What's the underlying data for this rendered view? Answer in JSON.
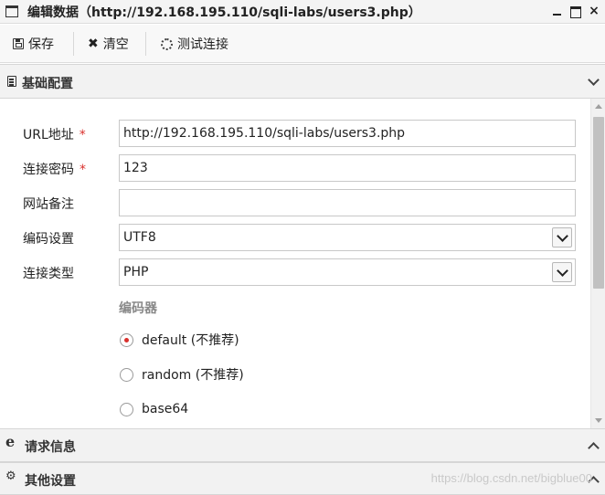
{
  "window": {
    "title": "编辑数据（http://192.168.195.110/sqli-labs/users3.php）",
    "minimize": "_",
    "close": "×"
  },
  "toolbar": {
    "save_label": "保存",
    "clear_label": "清空",
    "test_label": "测试连接"
  },
  "sections": {
    "basic": "基础配置",
    "request": "请求信息",
    "other": "其他设置"
  },
  "form": {
    "url_label": "URL地址",
    "url_value": "http://192.168.195.110/sqli-labs/users3.php",
    "password_label": "连接密码",
    "password_value": "123",
    "note_label": "网站备注",
    "note_value": "",
    "encoding_label": "编码设置",
    "encoding_value": "UTF8",
    "type_label": "连接类型",
    "type_value": "PHP",
    "required_mark": "*"
  },
  "encoder": {
    "label": "编码器",
    "options": [
      {
        "label": "default (不推荐)",
        "checked": true
      },
      {
        "label": "random (不推荐)",
        "checked": false
      },
      {
        "label": "base64",
        "checked": false
      }
    ]
  },
  "watermark": "https://blog.csdn.net/bigblue00",
  "colors": {
    "required": "#d9302c",
    "radio_selected": "#d9302c"
  },
  "icons": {
    "window": "window-icon",
    "save": "save-icon",
    "clear": "close-x-icon",
    "test": "spinner-icon",
    "basic": "document-icon",
    "request": "edge-e-icon",
    "other": "gears-icon"
  }
}
